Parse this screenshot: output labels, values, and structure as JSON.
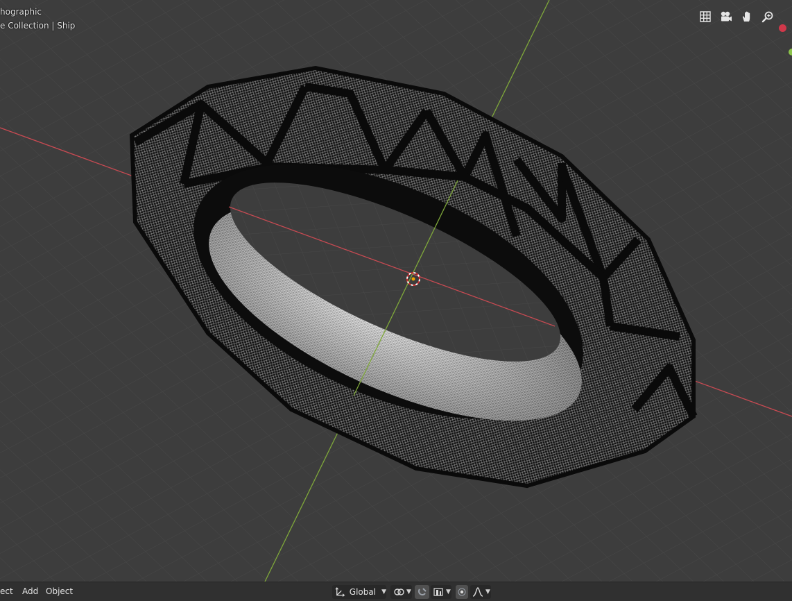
{
  "viewport": {
    "view_name": "hographic",
    "collection_path": "e Collection | Ship"
  },
  "nav_gizmos": [
    {
      "name": "toggle-ortho-grid-icon"
    },
    {
      "name": "camera-view-icon"
    },
    {
      "name": "pan-hand-icon"
    },
    {
      "name": "zoom-magnifier-icon"
    }
  ],
  "colors": {
    "x_axis": "#c74a52",
    "y_axis": "#7fa83a",
    "background": "#3d3d3d",
    "grid": "#484848",
    "header_bar": "#303030"
  },
  "header": {
    "menu": [
      "ect",
      "Add",
      "Object"
    ],
    "transform_orientation": "Global"
  }
}
